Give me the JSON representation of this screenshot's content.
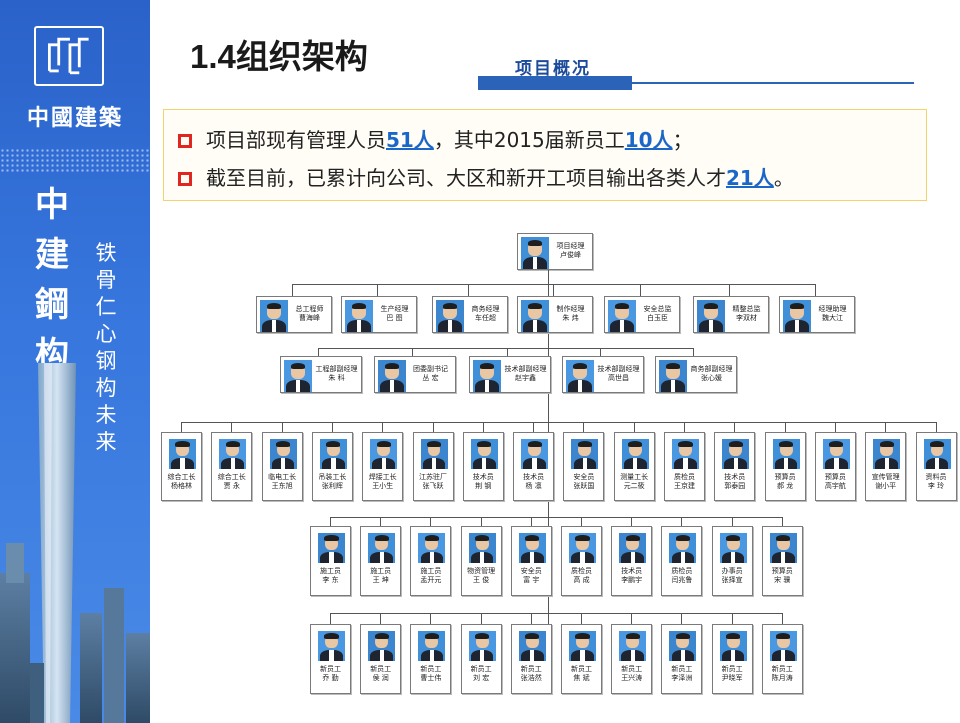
{
  "banner": {
    "brand": "中國建築",
    "main_vertical": "中建鋼构",
    "slogan_vertical": "铁骨仁心 钢构未来",
    "colors": {
      "banner": "#2a62c9",
      "accent_red": "#e0271f",
      "highlight_blue": "#1a66c9"
    }
  },
  "header": {
    "title": "1.4组织架构",
    "section_tab": "项目概况"
  },
  "summary": {
    "line1": {
      "pre": "项目部现有管理人员",
      "n1": "51人",
      "mid": "，其中2015届新员工",
      "n2": "10人",
      "post": "；"
    },
    "line2": {
      "pre": "截至目前，已累计向公司、大区和新开工项目输出各类人才",
      "n1": "21人",
      "post": "。"
    }
  },
  "org": {
    "top": {
      "role": "项目经理",
      "name": "卢俊峰"
    },
    "row1": [
      {
        "role": "总工程师",
        "name": "曹海峰"
      },
      {
        "role": "生产经理",
        "name": "巴 图"
      },
      {
        "role": "商务经理",
        "name": "车任超"
      },
      {
        "role": "制作经理",
        "name": "朱 炜"
      },
      {
        "role": "安全总监",
        "name": "白玉臣"
      },
      {
        "role": "精整总监",
        "name": "李双材"
      },
      {
        "role": "经理助理",
        "name": "魏大江"
      }
    ],
    "row2": [
      {
        "role": "工程部副经理",
        "name": "朱 科"
      },
      {
        "role": "团委副书记",
        "name": "丛 宏"
      },
      {
        "role": "技术部副经理",
        "name": "赵宇鑫"
      },
      {
        "role": "技术部副经理",
        "name": "高世昌"
      },
      {
        "role": "商务部副经理",
        "name": "张心媛"
      }
    ],
    "row3": [
      {
        "role": "综合工长",
        "name": "杨格林"
      },
      {
        "role": "综合工长",
        "name": "贾 永"
      },
      {
        "role": "临电工长",
        "name": "王东旭"
      },
      {
        "role": "吊装工长",
        "name": "张利辉"
      },
      {
        "role": "焊接工长",
        "name": "王小生"
      },
      {
        "role": "江苏驻厂",
        "name": "张飞跃"
      },
      {
        "role": "技术员",
        "name": "荆 钢"
      },
      {
        "role": "技术员",
        "name": "杨 凛"
      },
      {
        "role": "安全员",
        "name": "张跃国"
      },
      {
        "role": "测量工长",
        "name": "元二筱"
      },
      {
        "role": "质检员",
        "name": "王京建"
      },
      {
        "role": "技术员",
        "name": "郭泰园"
      },
      {
        "role": "预算员",
        "name": "郝 龙"
      },
      {
        "role": "预算员",
        "name": "高宇航"
      },
      {
        "role": "宣传管理",
        "name": "谢小平"
      },
      {
        "role": "资料员",
        "name": "李 玲"
      }
    ],
    "row4": [
      {
        "role": "施工员",
        "name": "李 东"
      },
      {
        "role": "施工员",
        "name": "王 坤"
      },
      {
        "role": "施工员",
        "name": "孟开元"
      },
      {
        "role": "物资管理",
        "name": "王 俊"
      },
      {
        "role": "安全员",
        "name": "富 宇"
      },
      {
        "role": "质检员",
        "name": "高 成"
      },
      {
        "role": "技术员",
        "name": "李鹏宇"
      },
      {
        "role": "质检员",
        "name": "闫兆鲁"
      },
      {
        "role": "办事员",
        "name": "张择宣"
      },
      {
        "role": "预算员",
        "name": "宋 骥"
      }
    ],
    "row5": [
      {
        "role": "新员工",
        "name": "乔 勤"
      },
      {
        "role": "新员工",
        "name": "侯 润"
      },
      {
        "role": "新员工",
        "name": "曹士伟"
      },
      {
        "role": "新员工",
        "name": "刘 宏"
      },
      {
        "role": "新员工",
        "name": "张浩然"
      },
      {
        "role": "新员工",
        "name": "焦 斌"
      },
      {
        "role": "新员工",
        "name": "王兴涛"
      },
      {
        "role": "新员工",
        "name": "李泽洲"
      },
      {
        "role": "新员工",
        "name": "尹晓军"
      },
      {
        "role": "新员工",
        "name": "陈月涛"
      }
    ]
  }
}
